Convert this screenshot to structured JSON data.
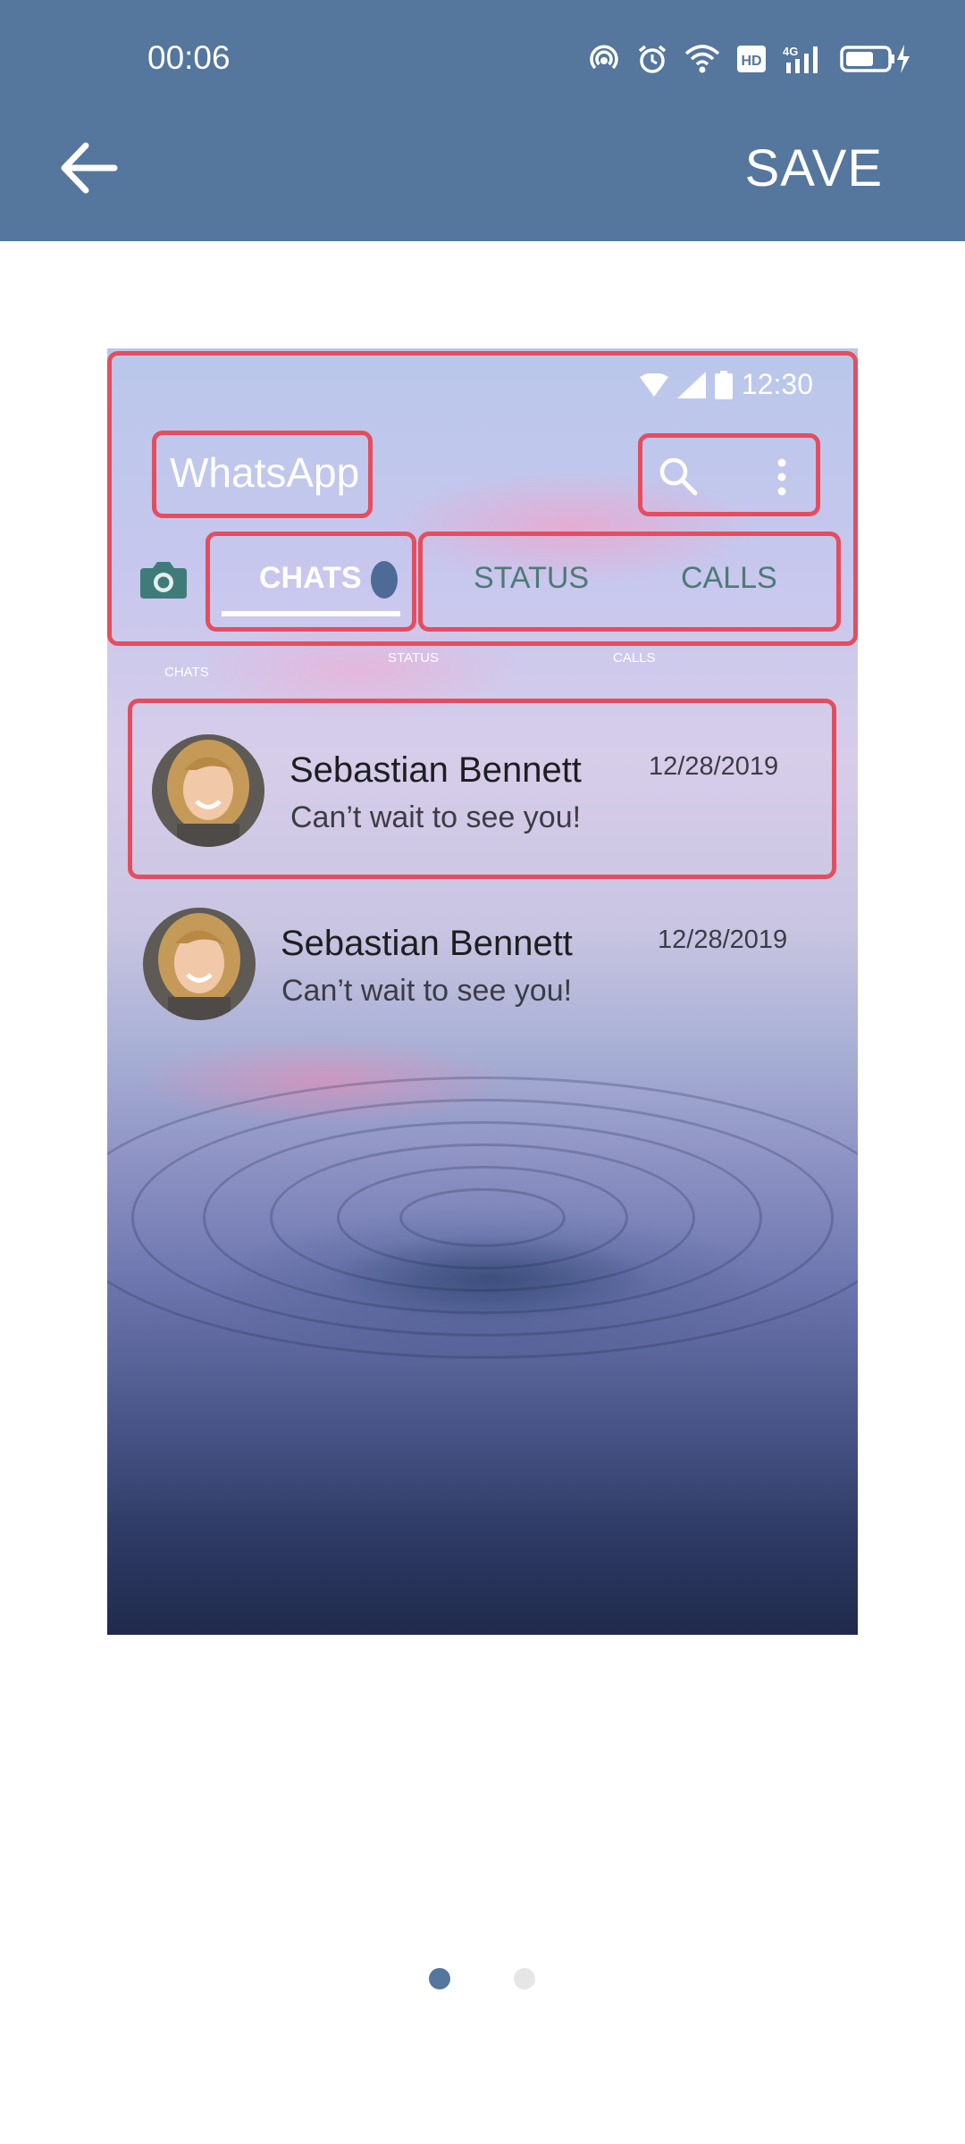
{
  "status_bar": {
    "time": "00:06"
  },
  "appbar": {
    "save_label": "SAVE"
  },
  "preview": {
    "status_time": "12:30",
    "app_title": "WhatsApp",
    "tabs": [
      {
        "label": "CHATS",
        "caption": "CHATS"
      },
      {
        "label": "STATUS",
        "caption": "STATUS"
      },
      {
        "label": "CALLS",
        "caption": "CALLS"
      }
    ],
    "chats": [
      {
        "name": "Sebastian Bennett",
        "message": "Can’t wait to see you!",
        "date": "12/28/2019"
      },
      {
        "name": "Sebastian Bennett",
        "message": "Can’t wait to see you!",
        "date": "12/28/2019"
      }
    ]
  },
  "pager": {
    "pages": 2,
    "current": 1
  },
  "colors": {
    "appbar": "#55769d",
    "highlight": "#e54d5e",
    "tab_teal": "#4d7a77",
    "pager_active": "#55769d",
    "pager_inactive": "#e6e6e6"
  }
}
